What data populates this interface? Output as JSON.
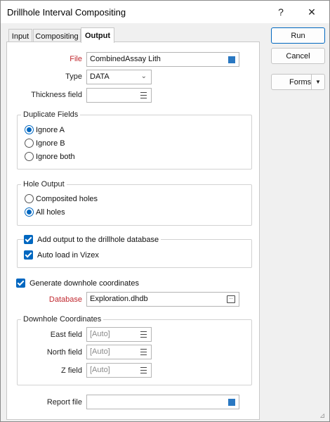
{
  "window": {
    "title": "Drillhole Interval Compositing",
    "help_glyph": "?",
    "close_glyph": "✕"
  },
  "tabs": [
    {
      "label": "Input",
      "active": false
    },
    {
      "label": "Compositing",
      "active": false
    },
    {
      "label": "Output",
      "active": true
    }
  ],
  "output": {
    "file_label": "File",
    "file_value": "CombinedAssay Lith",
    "type_label": "Type",
    "type_value": "DATA",
    "thickness_label": "Thickness field",
    "thickness_value": "",
    "duplicate_fields": {
      "title": "Duplicate Fields",
      "options": [
        "Ignore A",
        "Ignore B",
        "Ignore both"
      ],
      "selected": "Ignore A"
    },
    "hole_output": {
      "title": "Hole Output",
      "options": [
        "Composited holes",
        "All holes"
      ],
      "selected": "All holes"
    },
    "add_output_label": "Add output to the drillhole database",
    "add_output_checked": true,
    "auto_load_label": "Auto load in Vizex",
    "auto_load_checked": true,
    "generate_coords_label": "Generate downhole coordinates",
    "generate_coords_checked": true,
    "database_label": "Database",
    "database_value": "Exploration.dhdb",
    "downhole_coords": {
      "title": "Downhole Coordinates",
      "east_label": "East field",
      "east_value": "[Auto]",
      "north_label": "North field",
      "north_value": "[Auto]",
      "z_label": "Z field",
      "z_value": "[Auto]"
    },
    "report_label": "Report file",
    "report_value": ""
  },
  "buttons": {
    "run": "Run",
    "cancel": "Cancel",
    "forms": "Forms"
  },
  "colors": {
    "accent": "#0067c0",
    "required_label": "#c0282f",
    "file_square": "#2a78c2"
  },
  "icons": [
    "help-icon",
    "close-icon",
    "file-browse-icon",
    "list-icon",
    "dropdown-chevron-icon",
    "browse-ellipsis-icon",
    "split-arrow-icon",
    "resize-grip-icon"
  ]
}
